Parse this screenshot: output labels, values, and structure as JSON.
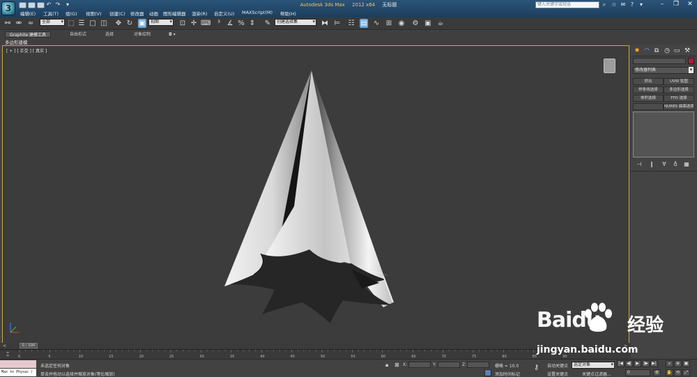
{
  "title": {
    "product": "Autodesk 3ds Max",
    "version": "2012 x64",
    "doc": "无标题"
  },
  "menu": [
    "编辑(E)",
    "工具(T)",
    "组(G)",
    "视图(V)",
    "创建(C)",
    "修改器",
    "动画",
    "图形编辑器",
    "渲染(R)",
    "自定义(U)",
    "MAXScript(M)",
    "帮助(H)"
  ],
  "search": {
    "placeholder": "键入关键字或短语"
  },
  "toolbar": {
    "filter_value": "全部",
    "refcoord_value": "视图",
    "named_selection_placeholder": "创建选择集"
  },
  "ribbon": {
    "tabs": [
      "Graphite 建模工具",
      "自由形式",
      "选择",
      "对象绘制"
    ],
    "sub_label": "多边形建模"
  },
  "viewport": {
    "label": "[ + ] [ 正交 ] [ 真实 ]"
  },
  "command_panel": {
    "modifier_list": "修改器列表",
    "buttons": [
      "挤出",
      "UVW 贴图",
      "样条线选择",
      "多边形选择",
      "体积选择",
      "FFD 选择",
      "",
      "NURBS 曲面选择"
    ]
  },
  "timeline": {
    "frame_label": "0 / 100",
    "ticks": [
      "0",
      "5",
      "10",
      "15",
      "20",
      "25",
      "30",
      "35",
      "40",
      "45",
      "50",
      "55",
      "60",
      "65",
      "70",
      "75",
      "80",
      "85",
      "90"
    ]
  },
  "status": {
    "maxscript_label": "Max to Physac (",
    "line1": "未选定任何对象",
    "line2": "单击并拖动以选择并缩放对象(等比缩放)",
    "x_label": "X:",
    "y_label": "Y:",
    "z_label": "Z:",
    "grid": "栅格 = 10.0",
    "auto_key": "自动关键点",
    "set_key": "设置关键点",
    "selected_object": "选定对象",
    "key_filter": "关键点过滤器...",
    "add_time_tag": "添加时间标记",
    "frame_value": "0"
  },
  "watermark": {
    "brand": "Baidu",
    "cn": "经验",
    "url": "jingyan.baidu.com"
  },
  "colors": {
    "viewport_border": "#c9a842",
    "object_color": "#b01e3c",
    "titlebar": "#2a5478",
    "active_tool": "#6aa6d8"
  }
}
